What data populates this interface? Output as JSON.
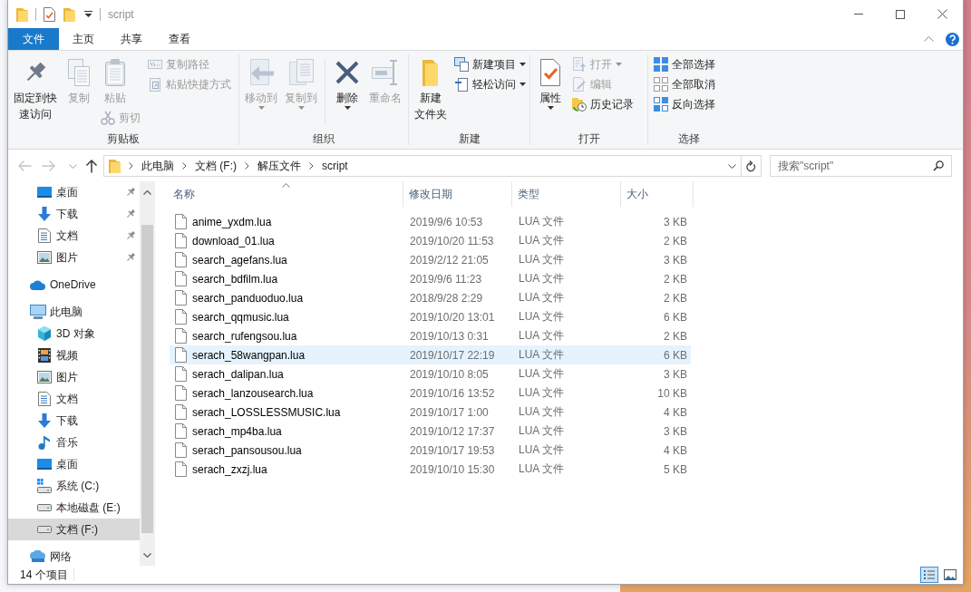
{
  "window": {
    "title": "script"
  },
  "ribbon_tabs": [
    {
      "label": "文件",
      "kind": "file"
    },
    {
      "label": "主页",
      "kind": "tab"
    },
    {
      "label": "共享",
      "kind": "tab"
    },
    {
      "label": "查看",
      "kind": "tab"
    }
  ],
  "ribbon": {
    "groups": [
      {
        "label": "剪贴板",
        "columns": [
          {
            "kind": "stack",
            "buttons": [
              {
                "kind": "large",
                "label": "固定到快速访问",
                "disabled": false,
                "dropdown": false
              }
            ]
          },
          {
            "kind": "stack",
            "buttons": [
              {
                "kind": "large",
                "label": "复制",
                "disabled": true,
                "dropdown": false
              }
            ]
          },
          {
            "kind": "stack",
            "buttons": [
              {
                "kind": "large",
                "label": "粘贴",
                "disabled": true,
                "dropdown": false
              },
              {
                "kind": "small",
                "label": "剪切",
                "disabled": true,
                "dropdown": false
              }
            ]
          },
          {
            "kind": "stack",
            "buttons": [
              {
                "kind": "small",
                "label": "复制路径",
                "disabled": true,
                "dropdown": false
              },
              {
                "kind": "small",
                "label": "粘贴快捷方式",
                "disabled": true,
                "dropdown": false
              }
            ]
          }
        ]
      },
      {
        "label": "组织",
        "columns": [
          {
            "kind": "stack",
            "buttons": [
              {
                "kind": "large",
                "label": "移动到",
                "disabled": true,
                "dropdown": true
              }
            ]
          },
          {
            "kind": "stack",
            "buttons": [
              {
                "kind": "large",
                "label": "复制到",
                "disabled": true,
                "dropdown": true
              }
            ]
          },
          {
            "kind": "divider"
          },
          {
            "kind": "stack",
            "buttons": [
              {
                "kind": "large",
                "label": "删除",
                "disabled": false,
                "dropdown": true
              }
            ]
          },
          {
            "kind": "stack",
            "buttons": [
              {
                "kind": "large",
                "label": "重命名",
                "disabled": true,
                "dropdown": false
              }
            ]
          }
        ]
      },
      {
        "label": "新建",
        "columns": [
          {
            "kind": "stack",
            "buttons": [
              {
                "kind": "large",
                "label": "新建文件夹",
                "disabled": false,
                "dropdown": false
              }
            ]
          },
          {
            "kind": "stack",
            "buttons": [
              {
                "kind": "small",
                "label": "新建项目",
                "disabled": false,
                "dropdown": true
              },
              {
                "kind": "small",
                "label": "轻松访问",
                "disabled": false,
                "dropdown": true
              }
            ]
          }
        ]
      },
      {
        "label": "打开",
        "columns": [
          {
            "kind": "stack",
            "buttons": [
              {
                "kind": "large",
                "label": "属性",
                "disabled": false,
                "dropdown": true
              }
            ]
          },
          {
            "kind": "stack",
            "buttons": [
              {
                "kind": "small",
                "label": "打开",
                "disabled": true,
                "dropdown": true
              },
              {
                "kind": "small",
                "label": "编辑",
                "disabled": true,
                "dropdown": false
              },
              {
                "kind": "small",
                "label": "历史记录",
                "disabled": false,
                "dropdown": false
              }
            ]
          }
        ]
      },
      {
        "label": "选择",
        "columns": [
          {
            "kind": "stack",
            "buttons": [
              {
                "kind": "small",
                "label": "全部选择",
                "disabled": false,
                "dropdown": false
              },
              {
                "kind": "small",
                "label": "全部取消",
                "disabled": false,
                "dropdown": false
              },
              {
                "kind": "small",
                "label": "反向选择",
                "disabled": false,
                "dropdown": false
              }
            ]
          }
        ]
      }
    ]
  },
  "address_bar": {
    "nav_buttons": [
      {
        "kind": "back",
        "disabled": true
      },
      {
        "kind": "forward",
        "disabled": true
      },
      {
        "kind": "recent",
        "disabled": false
      },
      {
        "kind": "up",
        "disabled": false
      }
    ],
    "breadcrumbs": [
      "此电脑",
      "文档 (F:)",
      "解压文件",
      "script"
    ]
  },
  "search": {
    "placeholder": "搜索\"script\""
  },
  "navigation_pane": {
    "quick_access": [
      {
        "label": "桌面",
        "pinned": true,
        "selected": false
      },
      {
        "label": "下载",
        "pinned": true,
        "selected": false
      },
      {
        "label": "文档",
        "pinned": true,
        "selected": false
      },
      {
        "label": "图片",
        "pinned": true,
        "selected": false
      }
    ],
    "tree": [
      {
        "label": "OneDrive",
        "selected": false
      },
      {
        "label": "此电脑",
        "selected": false,
        "children": [
          {
            "label": "3D 对象",
            "selected": false
          },
          {
            "label": "视频",
            "selected": false
          },
          {
            "label": "图片",
            "selected": false
          },
          {
            "label": "文档",
            "selected": false
          },
          {
            "label": "下载",
            "selected": false
          },
          {
            "label": "音乐",
            "selected": false
          },
          {
            "label": "桌面",
            "selected": false
          },
          {
            "label": "系统 (C:)",
            "selected": false
          },
          {
            "label": "本地磁盘 (E:)",
            "selected": false
          },
          {
            "label": "文档 (F:)",
            "selected": true
          }
        ]
      },
      {
        "label": "网络",
        "selected": false
      }
    ]
  },
  "file_list": {
    "columns": [
      {
        "label": "名称",
        "sorted": true
      },
      {
        "label": "修改日期",
        "sorted": false
      },
      {
        "label": "类型",
        "sorted": false
      },
      {
        "label": "大小",
        "sorted": false
      }
    ],
    "rows": [
      {
        "name": "anime_yxdm.lua",
        "modified": "2019/9/6 10:53",
        "type": "LUA 文件",
        "size": "3 KB",
        "hovered": false
      },
      {
        "name": "download_01.lua",
        "modified": "2019/10/20 11:53",
        "type": "LUA 文件",
        "size": "2 KB",
        "hovered": false
      },
      {
        "name": "search_agefans.lua",
        "modified": "2019/2/12 21:05",
        "type": "LUA 文件",
        "size": "3 KB",
        "hovered": false
      },
      {
        "name": "search_bdfilm.lua",
        "modified": "2019/9/6 11:23",
        "type": "LUA 文件",
        "size": "2 KB",
        "hovered": false
      },
      {
        "name": "search_panduoduo.lua",
        "modified": "2018/9/28 2:29",
        "type": "LUA 文件",
        "size": "2 KB",
        "hovered": false
      },
      {
        "name": "search_qqmusic.lua",
        "modified": "2019/10/20 13:01",
        "type": "LUA 文件",
        "size": "6 KB",
        "hovered": false
      },
      {
        "name": "search_rufengsou.lua",
        "modified": "2019/10/13 0:31",
        "type": "LUA 文件",
        "size": "2 KB",
        "hovered": false
      },
      {
        "name": "serach_58wangpan.lua",
        "modified": "2019/10/17 22:19",
        "type": "LUA 文件",
        "size": "6 KB",
        "hovered": true
      },
      {
        "name": "serach_dalipan.lua",
        "modified": "2019/10/10 8:05",
        "type": "LUA 文件",
        "size": "3 KB",
        "hovered": false
      },
      {
        "name": "serach_lanzousearch.lua",
        "modified": "2019/10/16 13:52",
        "type": "LUA 文件",
        "size": "10 KB",
        "hovered": false
      },
      {
        "name": "serach_LOSSLESSMUSIC.lua",
        "modified": "2019/10/17 1:00",
        "type": "LUA 文件",
        "size": "4 KB",
        "hovered": false
      },
      {
        "name": "serach_mp4ba.lua",
        "modified": "2019/10/12 17:37",
        "type": "LUA 文件",
        "size": "3 KB",
        "hovered": false
      },
      {
        "name": "serach_pansousou.lua",
        "modified": "2019/10/17 19:53",
        "type": "LUA 文件",
        "size": "4 KB",
        "hovered": false
      },
      {
        "name": "serach_zxzj.lua",
        "modified": "2019/10/10 15:30",
        "type": "LUA 文件",
        "size": "5 KB",
        "hovered": false
      }
    ]
  },
  "status_bar": {
    "item_count": "14 个项目",
    "views": [
      {
        "kind": "details",
        "selected": true
      },
      {
        "kind": "large_icons",
        "selected": false
      }
    ]
  }
}
